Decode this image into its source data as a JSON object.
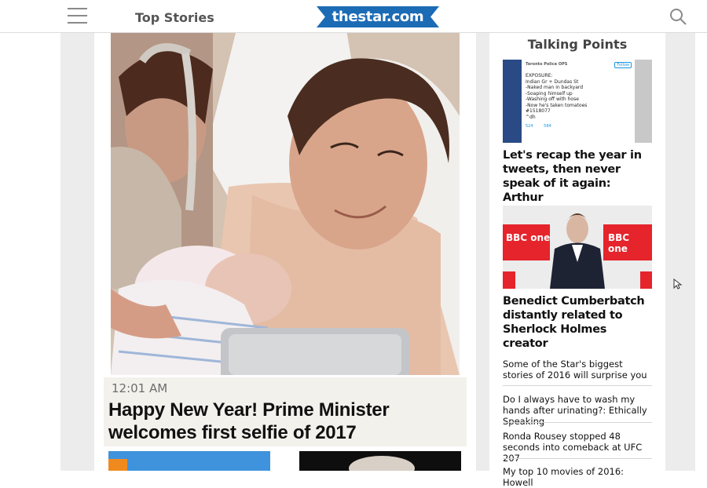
{
  "header": {
    "section_title": "Top Stories",
    "logo_text": "thestar.com"
  },
  "colors": {
    "brand_blue": "#1c6bb5",
    "page_gray": "#ececec"
  },
  "icons": {
    "menu": "hamburger-menu-icon",
    "search": "search-icon"
  },
  "main": {
    "timestamp": "12:01 AM",
    "headline": "Happy New Year! Prime Minister welcomes first selfie of 2017"
  },
  "sidebar": {
    "heading": "Talking Points",
    "tweet": {
      "account": "Toronto Police OPS",
      "follow_label": "Follow",
      "lines": [
        "EXPOSURE:",
        "Indian Gr + Dundas St",
        "-Naked man in backyard",
        "-Soaping himself up",
        "-Washing off with hose",
        "-Now he's taken tomatoes",
        "#1518077",
        "^dh"
      ],
      "stat1": "524",
      "stat2": "584"
    },
    "img2_brand": "BBC one",
    "stories": [
      {
        "title": "Let's recap the year in tweets, then never speak of it again: Arthur"
      },
      {
        "title": "Benedict Cumberbatch distantly related to Sherlock Holmes creator"
      }
    ],
    "links": [
      {
        "title": "Some of the Star's biggest stories of 2016 will surprise you"
      },
      {
        "title": "Do I always have to wash my hands after urinating?: Ethically Speaking"
      },
      {
        "title": "Ronda Rousey stopped 48 seconds into comeback at UFC 207"
      },
      {
        "title": "My top 10 movies of 2016: Howell"
      }
    ]
  }
}
